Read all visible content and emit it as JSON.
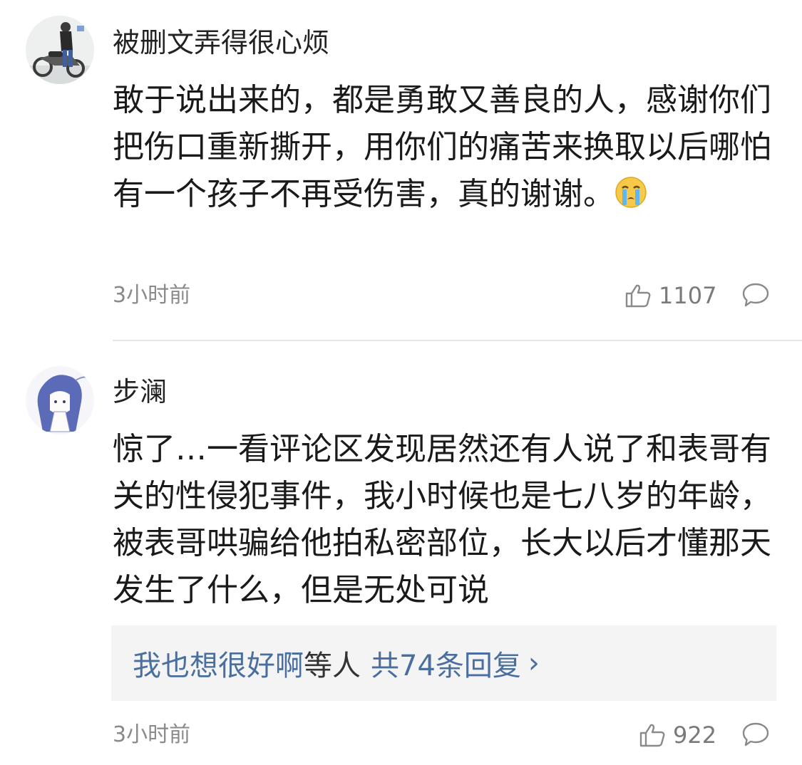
{
  "comments": [
    {
      "username": "被删文弄得很心烦",
      "text": "敢于说出来的，都是勇敢又善良的人，感谢你们把伤口重新撕开，用你们的痛苦来换取以后哪怕有一个孩子不再受伤害，真的谢谢。",
      "emoji": "crying-face",
      "time": "3小时前",
      "likes": "1107"
    },
    {
      "username": "步澜",
      "text": "惊了…一看评论区发现居然还有人说了和表哥有关的性侵犯事件，我小时候也是七八岁的年龄，被表哥哄骗给他拍私密部位，长大以后才懂那天发生了什么，但是无处可说",
      "time": "3小时前",
      "likes": "922",
      "replies": {
        "replier": "我也想很好啊",
        "connector": "等人",
        "count_label": "共74条回复",
        "chevron": "›"
      }
    }
  ],
  "colors": {
    "link_blue": "#4a6f9f",
    "meta_gray": "#8a8a8a",
    "reply_bg": "#f4f4f4"
  }
}
